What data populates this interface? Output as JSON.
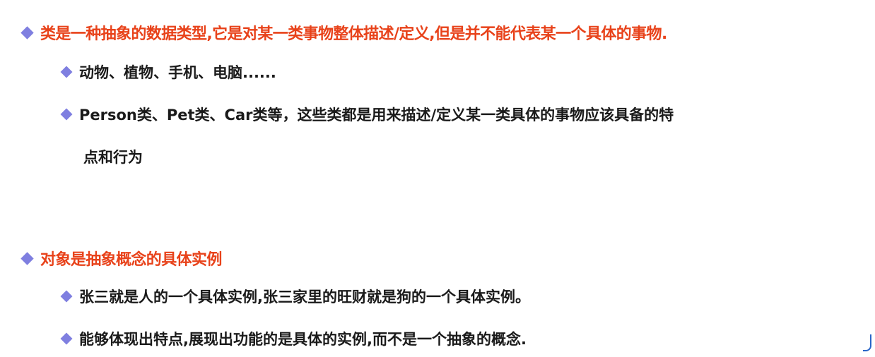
{
  "section1": {
    "heading": "类是一种抽象的数据类型,它是对某一类事物整体描述/定义,但是并不能代表某一个具体的事物.",
    "items": [
      "动物、植物、手机、电脑......",
      "Person类、Pet类、Car类等，这些类都是用来描述/定义某一类具体的事物应该具备的特",
      "点和行为"
    ]
  },
  "section2": {
    "heading": "对象是抽象概念的具体实例",
    "items": [
      "张三就是人的一个具体实例,张三家里的旺财就是狗的一个具体实例。",
      "能够体现出特点,展现出功能的是具体的实例,而不是一个抽象的概念."
    ]
  },
  "colors": {
    "heading": "#e8421a",
    "text": "#1a1a1a",
    "bullet": "#7f7fe0"
  }
}
